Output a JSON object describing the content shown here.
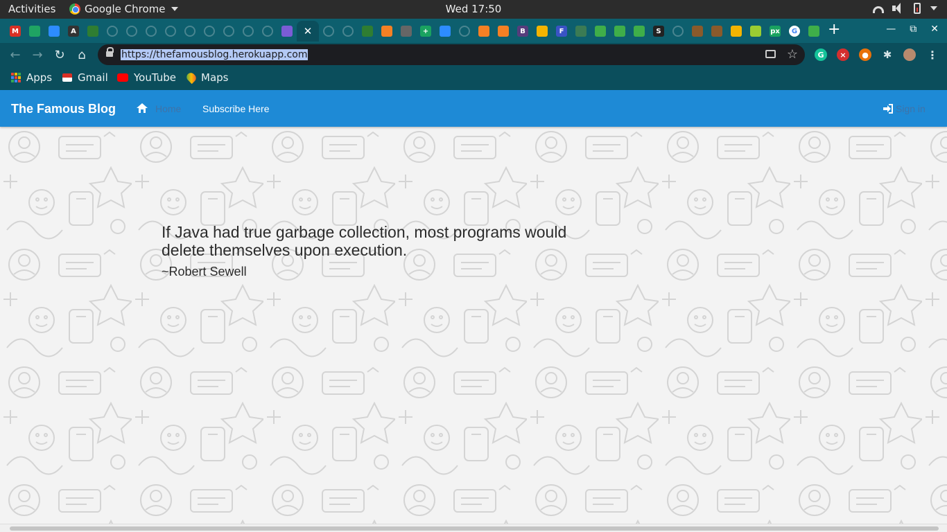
{
  "system_bar": {
    "activities": "Activities",
    "app_name": "Google Chrome",
    "clock": "Wed 17:50"
  },
  "browser": {
    "tabs": [
      {
        "icon": "gmail-icon",
        "color": "#d93025",
        "glyph": "M"
      },
      {
        "icon": "google-drive-icon",
        "color": "#1fa463",
        "glyph": ""
      },
      {
        "icon": "zoom-icon",
        "color": "#2d8cff",
        "glyph": ""
      },
      {
        "icon": "app-icon",
        "color": "#333333",
        "glyph": "A"
      },
      {
        "icon": "tree-icon",
        "color": "#2f7d32",
        "glyph": ""
      },
      {
        "icon": "github-icon",
        "color": "#4a8590",
        "glyph": ""
      },
      {
        "icon": "github-icon",
        "color": "#4a8590",
        "glyph": ""
      },
      {
        "icon": "github-icon",
        "color": "#4a8590",
        "glyph": ""
      },
      {
        "icon": "site-icon",
        "color": "#4a8590",
        "glyph": ""
      },
      {
        "icon": "github-icon",
        "color": "#4a8590",
        "glyph": ""
      },
      {
        "icon": "site-icon",
        "color": "#4a8590",
        "glyph": ""
      },
      {
        "icon": "github-icon",
        "color": "#4a8590",
        "glyph": ""
      },
      {
        "icon": "site-icon",
        "color": "#4a8590",
        "glyph": ""
      },
      {
        "icon": "github-icon",
        "color": "#4a8590",
        "glyph": ""
      },
      {
        "icon": "chat-icon",
        "color": "#7b5cd6",
        "glyph": ""
      }
    ],
    "tabs_after": [
      {
        "icon": "site-icon",
        "color": "#4a8590",
        "glyph": ""
      },
      {
        "icon": "site-icon",
        "color": "#222222",
        "glyph": ""
      },
      {
        "icon": "tree-icon",
        "color": "#2f7d32",
        "glyph": ""
      },
      {
        "icon": "stackoverflow-icon",
        "color": "#f48024",
        "glyph": ""
      },
      {
        "icon": "robot-icon",
        "color": "#666666",
        "glyph": ""
      },
      {
        "icon": "plus-icon",
        "color": "#1aa260",
        "glyph": "+"
      },
      {
        "icon": "zoom-icon",
        "color": "#2d8cff",
        "glyph": ""
      },
      {
        "icon": "site-icon",
        "color": "#4a8590",
        "glyph": ""
      },
      {
        "icon": "stackoverflow-icon",
        "color": "#f48024",
        "glyph": ""
      },
      {
        "icon": "stackoverflow-icon",
        "color": "#f48024",
        "glyph": ""
      },
      {
        "icon": "bootstrap-icon",
        "color": "#563d7c",
        "glyph": "B"
      },
      {
        "icon": "keep-icon",
        "color": "#f4b400",
        "glyph": ""
      },
      {
        "icon": "font-icon",
        "color": "#3a53c5",
        "glyph": "F"
      },
      {
        "icon": "leaf-icon",
        "color": "#3b7b54",
        "glyph": ""
      },
      {
        "icon": "chart-icon",
        "color": "#3fae49",
        "glyph": ""
      },
      {
        "icon": "chart-icon",
        "color": "#3fae49",
        "glyph": ""
      },
      {
        "icon": "chart-icon",
        "color": "#3fae49",
        "glyph": ""
      },
      {
        "icon": "s-icon",
        "color": "#222222",
        "glyph": "S"
      },
      {
        "icon": "site-icon",
        "color": "#4a8590",
        "glyph": ""
      },
      {
        "icon": "book-icon",
        "color": "#8a5a2b",
        "glyph": ""
      },
      {
        "icon": "book-icon",
        "color": "#8a5a2b",
        "glyph": ""
      },
      {
        "icon": "folder-icon",
        "color": "#f4b400",
        "glyph": ""
      },
      {
        "icon": "flower-icon",
        "color": "#9acd32",
        "glyph": ""
      },
      {
        "icon": "px-icon",
        "color": "#1aa260",
        "glyph": "px"
      },
      {
        "icon": "google-icon",
        "color": "#ffffff",
        "glyph": "G"
      },
      {
        "icon": "chart-icon",
        "color": "#3fae49",
        "glyph": ""
      }
    ],
    "url": "https://thefamousblog.herokuapp.com",
    "bookmarks": [
      {
        "label": "Apps",
        "icon": "apps-grid-icon"
      },
      {
        "label": "Gmail",
        "icon": "gmail-icon"
      },
      {
        "label": "YouTube",
        "icon": "youtube-icon"
      },
      {
        "label": "Maps",
        "icon": "maps-icon"
      }
    ]
  },
  "site": {
    "brand": "The Famous Blog",
    "nav": {
      "home": "Home",
      "subscribe": "Subscribe Here",
      "signin": "Sign in"
    },
    "quote": "If Java had true garbage collection, most programs would delete themselves upon execution.",
    "author": "~Robert Sewell",
    "colors": {
      "navbar": "#1e8ad6",
      "chrome_frame": "#0b4e5c",
      "tab_strip": "#0d5f6e"
    }
  }
}
